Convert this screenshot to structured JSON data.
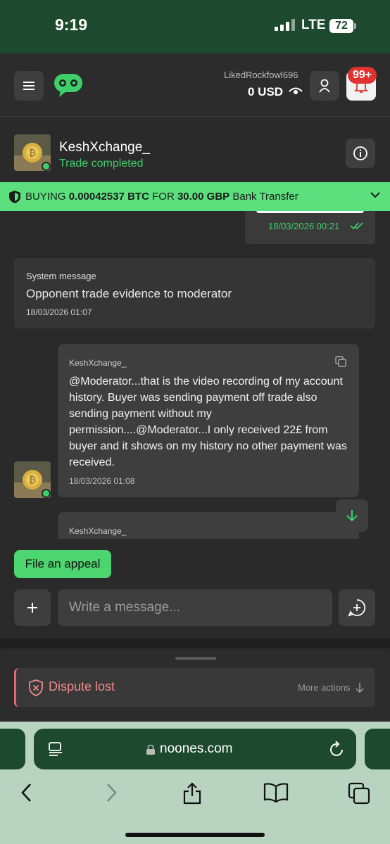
{
  "status_bar": {
    "time": "9:19",
    "network": "LTE",
    "battery": "72"
  },
  "header": {
    "username": "LikedRockfowl696",
    "balance": "0 USD",
    "notification_badge": "99+"
  },
  "counterparty": {
    "name": "KeshXchange_",
    "status": "Trade completed"
  },
  "trade_banner": {
    "action": "BUYING",
    "crypto_amount": "0.00042537 BTC",
    "for_word": "FOR",
    "fiat_amount": "30.00 GBP",
    "method": "Bank Transfer"
  },
  "chat": {
    "previous_message_time": "18/03/2026 00:21",
    "system_message": {
      "label": "System message",
      "text": "Opponent trade evidence to moderator",
      "time": "18/03/2026 01:07"
    },
    "messages": [
      {
        "sender": "KeshXchange_",
        "text": "@Moderator...that is the video recording of my account history. Buyer was sending payment off trade also sending payment without my permission....@Moderator...I only received 22£ from buyer and it shows on my history no other payment was received.",
        "time": "18/03/2026 01:08"
      },
      {
        "sender": "KeshXchange_"
      }
    ]
  },
  "appeal_button": "File an appeal",
  "composer": {
    "placeholder": "Write a message..."
  },
  "dispute": {
    "status": "Dispute lost",
    "more_actions": "More actions"
  },
  "browser": {
    "url": "noones.com"
  },
  "colors": {
    "accent_green": "#5ce07d",
    "dispute_red": "#f08a8a",
    "status_bar_bg": "#1d4a2e"
  }
}
